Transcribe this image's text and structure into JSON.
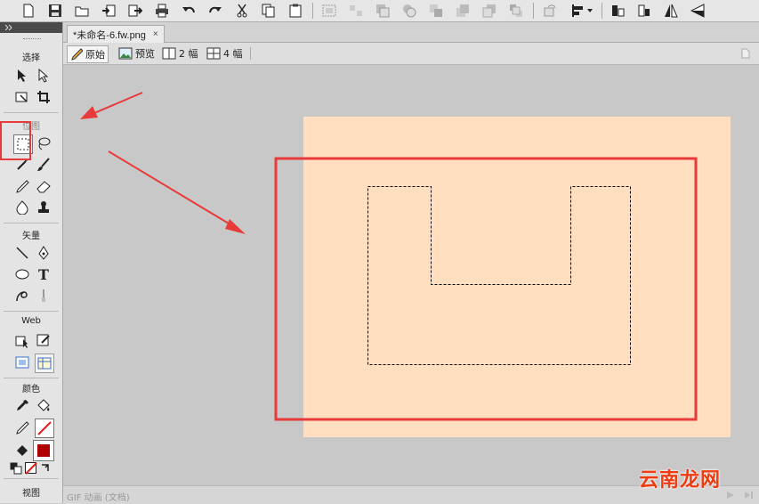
{
  "document": {
    "tab_title": "*未命名-6.fw.png",
    "close_glyph": "×"
  },
  "view_tabs": [
    {
      "label": "原始",
      "active": true
    },
    {
      "label": "预览"
    },
    {
      "label": "2 幅"
    },
    {
      "label": "4 幅"
    }
  ],
  "tools_panel": {
    "sections": [
      "选择",
      "位图",
      "矢量",
      "Web",
      "颜色",
      "视图"
    ],
    "text_tool_glyph": "T"
  },
  "status": {
    "text": "GIF 动画 (文档)"
  },
  "watermark": {
    "text": "云南龙网"
  },
  "colors": {
    "canvas_bg": "#c8c8c8",
    "document_fill": "#ffdfc0",
    "annotation_red": "#e83a3a",
    "stroke_color": "#b00000"
  },
  "toolbar_icons": [
    "new-icon",
    "save-icon",
    "open-icon",
    "import-icon",
    "export-icon",
    "print-icon",
    "undo-icon",
    "redo-icon",
    "cut-icon",
    "copy-icon",
    "paste-icon",
    "group-icon",
    "ungroup-icon",
    "join-icon",
    "split-icon",
    "bring-front-icon",
    "bring-forward-icon",
    "send-backward-icon",
    "send-back-icon",
    "rotate-icon",
    "align-icon",
    "flip-horizontal-icon",
    "flip-vertical-icon",
    "skew-icon"
  ]
}
